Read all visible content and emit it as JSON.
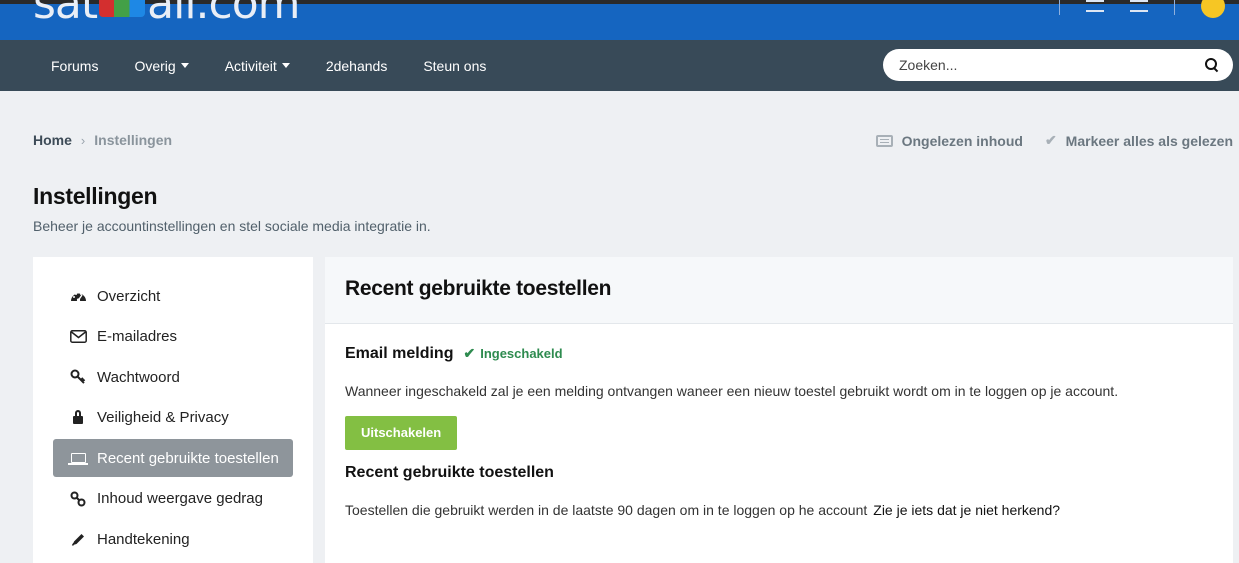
{
  "header": {
    "logo_text_left": "sat",
    "logo_text_right": "all.com",
    "logo_dot": "."
  },
  "nav": {
    "items": [
      {
        "label": "Forums",
        "dropdown": false
      },
      {
        "label": "Overig",
        "dropdown": true
      },
      {
        "label": "Activiteit",
        "dropdown": true
      },
      {
        "label": "2dehands",
        "dropdown": false
      },
      {
        "label": "Steun ons",
        "dropdown": false
      }
    ],
    "search_placeholder": "Zoeken..."
  },
  "breadcrumb": {
    "home": "Home",
    "current": "Instellingen"
  },
  "actions": {
    "unread": "Ongelezen inhoud",
    "mark_read": "Markeer alles als gelezen"
  },
  "page": {
    "title": "Instellingen",
    "description": "Beheer je accountinstellingen en stel sociale media integratie in."
  },
  "sidebar": {
    "items": [
      {
        "label": "Overzicht",
        "icon": "dashboard-icon",
        "active": false
      },
      {
        "label": "E-mailadres",
        "icon": "envelope-icon",
        "active": false
      },
      {
        "label": "Wachtwoord",
        "icon": "key-icon",
        "active": false
      },
      {
        "label": "Veiligheid & Privacy",
        "icon": "lock-icon",
        "active": false
      },
      {
        "label": "Recent gebruikte toestellen",
        "icon": "laptop-icon",
        "active": true
      },
      {
        "label": "Inhoud weergave gedrag",
        "icon": "link-icon",
        "active": false
      },
      {
        "label": "Handtekening",
        "icon": "pencil-icon",
        "active": false
      }
    ]
  },
  "main": {
    "title": "Recent gebruikte toestellen",
    "email_title": "Email melding",
    "status": "Ingeschakeld",
    "email_desc": "Wanneer ingeschakeld zal je een melding ontvangen waneer een nieuw toestel gebruikt wordt om in te loggen op je account.",
    "disable_button": "Uitschakelen",
    "devices_title": "Recent gebruikte toestellen",
    "devices_desc": "Toestellen die gebruikt werden in de laatste 90 dagen om in te loggen op he account",
    "devices_link": "Zie je iets dat je niet herkend?"
  },
  "colors": {
    "header_blue": "#1565c0",
    "nav_bg": "#384a58",
    "active_item": "#8e959b",
    "button_green": "#83bf43",
    "status_green": "#2e8b4f"
  }
}
